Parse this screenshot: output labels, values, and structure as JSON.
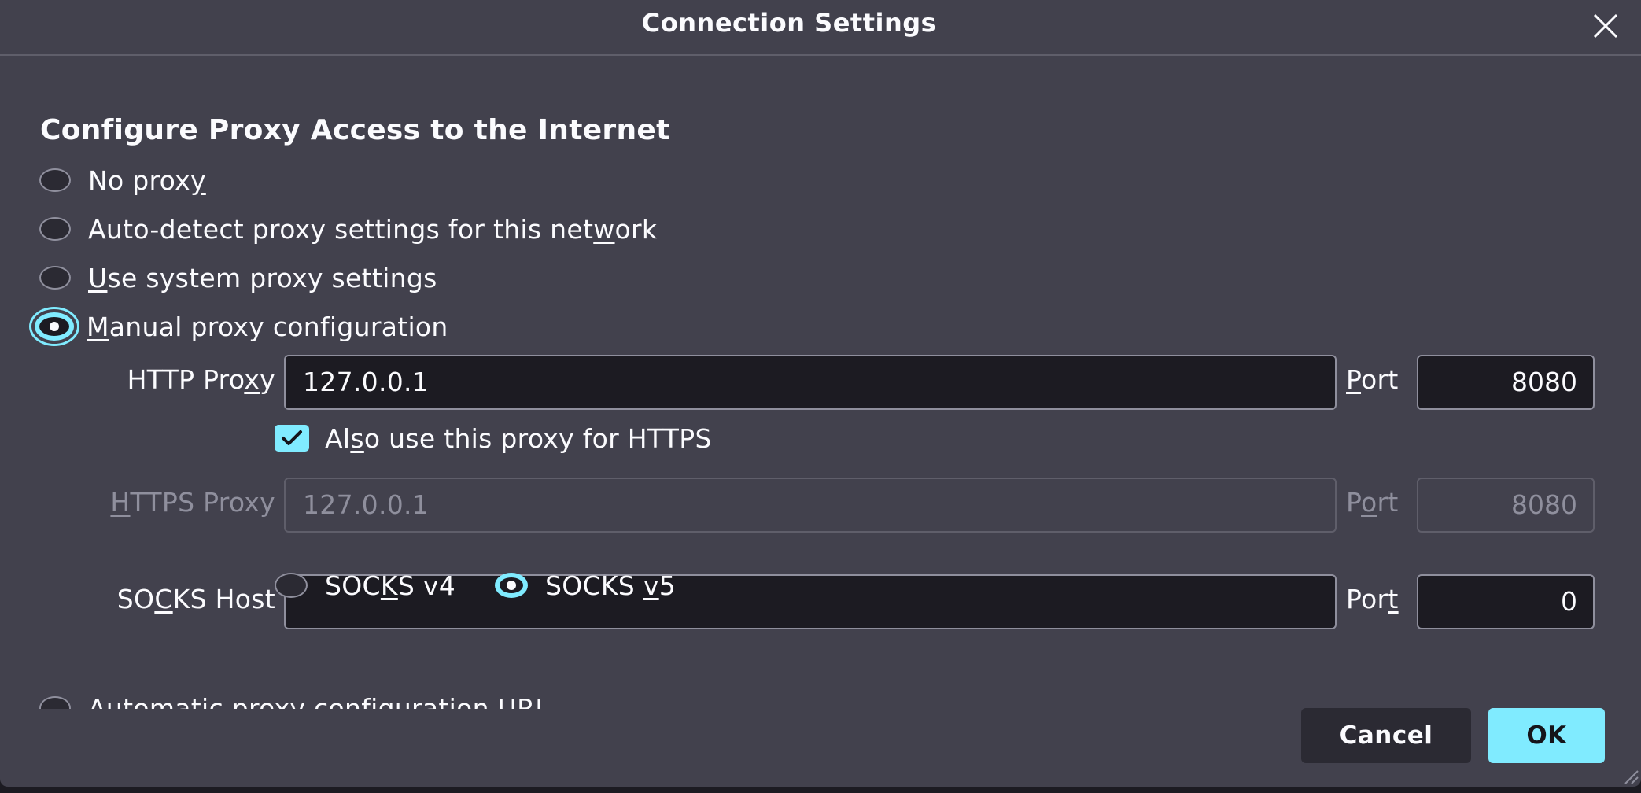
{
  "dialog": {
    "title": "Connection Settings",
    "close_icon": "close-icon"
  },
  "section": {
    "heading": "Configure Proxy Access to the Internet"
  },
  "proxy_options": [
    {
      "label_pre": "No prox",
      "label_key": "y",
      "label_post": "",
      "checked": false
    },
    {
      "label_pre": "Auto-detect proxy settings for this net",
      "label_key": "w",
      "label_post": "ork",
      "checked": false
    },
    {
      "label_pre": "",
      "label_key": "U",
      "label_post": "se system proxy settings",
      "checked": false
    },
    {
      "label_pre": "",
      "label_key": "M",
      "label_post": "anual proxy configuration",
      "checked": true
    },
    {
      "label_pre": "Automatic proxy configuration URL",
      "label_key": "",
      "label_post": "",
      "checked": false
    }
  ],
  "http": {
    "label_pre": "HTTP Pro",
    "label_key": "x",
    "label_post": "y",
    "value": "127.0.0.1",
    "port_label_key": "P",
    "port_label_post": "ort",
    "port": "8080"
  },
  "also_https": {
    "label_pre": "Al",
    "label_key": "s",
    "label_post": "o use this proxy for HTTPS",
    "checked": true
  },
  "https": {
    "label_key": "H",
    "label_post": "TTPS Proxy",
    "value": "127.0.0.1",
    "port_label_pre": "P",
    "port_label_key": "o",
    "port_label_post": "rt",
    "port": "8080",
    "disabled": true
  },
  "socks": {
    "label_pre": "SO",
    "label_key": "C",
    "label_post": "KS Host",
    "value": "",
    "port_label_pre": "Por",
    "port_label_key": "t",
    "port": "0",
    "v4_pre": "SOC",
    "v4_key": "K",
    "v4_post": "S v4",
    "v5_pre": "SOCKS ",
    "v5_key": "v",
    "v5_post": "5",
    "selected": "v5"
  },
  "buttons": {
    "cancel": "Cancel",
    "ok": "OK"
  },
  "colors": {
    "background": "#42414d",
    "accent": "#80ebff",
    "input_bg": "#1c1b22",
    "text": "#fbfbfe",
    "disabled_text": "#8f8f9d"
  }
}
